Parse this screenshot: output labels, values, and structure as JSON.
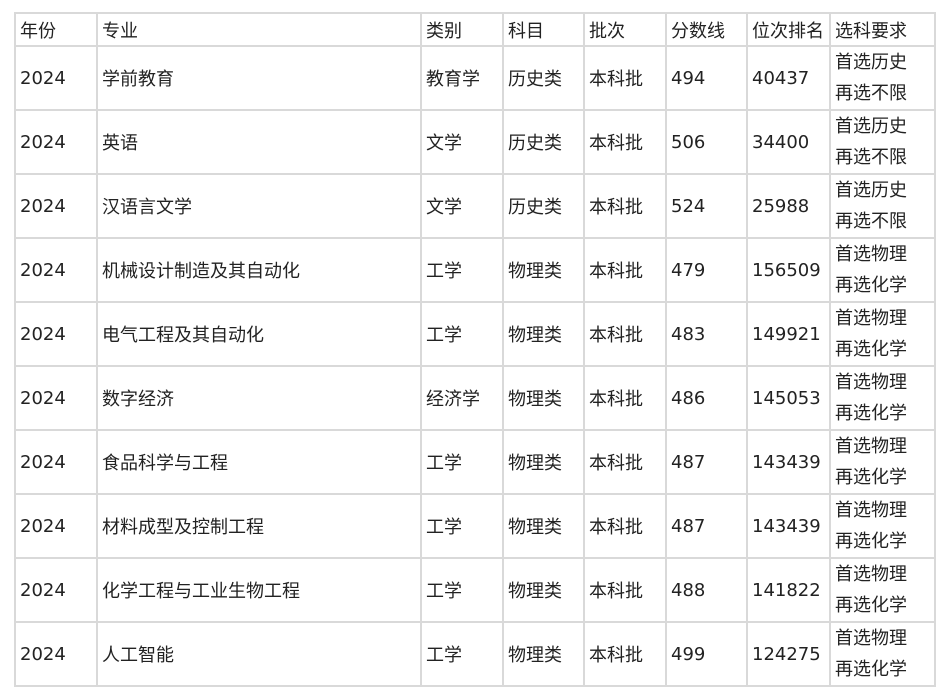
{
  "table": {
    "headers": [
      "年份",
      "专业",
      "类别",
      "科目",
      "批次",
      "分数线",
      "位次排名",
      "选科要求"
    ],
    "rows": [
      {
        "year": "2024",
        "major": "学前教育",
        "category": "教育学",
        "subject": "历史类",
        "batch": "本科批",
        "score": "494",
        "rank": "40437",
        "req1": "首选历史",
        "req2": "再选不限"
      },
      {
        "year": "2024",
        "major": "英语",
        "category": "文学",
        "subject": "历史类",
        "batch": "本科批",
        "score": "506",
        "rank": "34400",
        "req1": "首选历史",
        "req2": "再选不限"
      },
      {
        "year": "2024",
        "major": "汉语言文学",
        "category": "文学",
        "subject": "历史类",
        "batch": "本科批",
        "score": "524",
        "rank": "25988",
        "req1": "首选历史",
        "req2": "再选不限"
      },
      {
        "year": "2024",
        "major": "机械设计制造及其自动化",
        "category": "工学",
        "subject": "物理类",
        "batch": "本科批",
        "score": "479",
        "rank": "156509",
        "req1": "首选物理",
        "req2": "再选化学"
      },
      {
        "year": "2024",
        "major": "电气工程及其自动化",
        "category": "工学",
        "subject": "物理类",
        "batch": "本科批",
        "score": "483",
        "rank": "149921",
        "req1": "首选物理",
        "req2": "再选化学"
      },
      {
        "year": "2024",
        "major": "数字经济",
        "category": "经济学",
        "subject": "物理类",
        "batch": "本科批",
        "score": "486",
        "rank": "145053",
        "req1": "首选物理",
        "req2": "再选化学"
      },
      {
        "year": "2024",
        "major": "食品科学与工程",
        "category": "工学",
        "subject": "物理类",
        "batch": "本科批",
        "score": "487",
        "rank": "143439",
        "req1": "首选物理",
        "req2": "再选化学"
      },
      {
        "year": "2024",
        "major": "材料成型及控制工程",
        "category": "工学",
        "subject": "物理类",
        "batch": "本科批",
        "score": "487",
        "rank": "143439",
        "req1": "首选物理",
        "req2": "再选化学"
      },
      {
        "year": "2024",
        "major": "化学工程与工业生物工程",
        "category": "工学",
        "subject": "物理类",
        "batch": "本科批",
        "score": "488",
        "rank": "141822",
        "req1": "首选物理",
        "req2": "再选化学"
      },
      {
        "year": "2024",
        "major": "人工智能",
        "category": "工学",
        "subject": "物理类",
        "batch": "本科批",
        "score": "499",
        "rank": "124275",
        "req1": "首选物理",
        "req2": "再选化学"
      }
    ]
  }
}
